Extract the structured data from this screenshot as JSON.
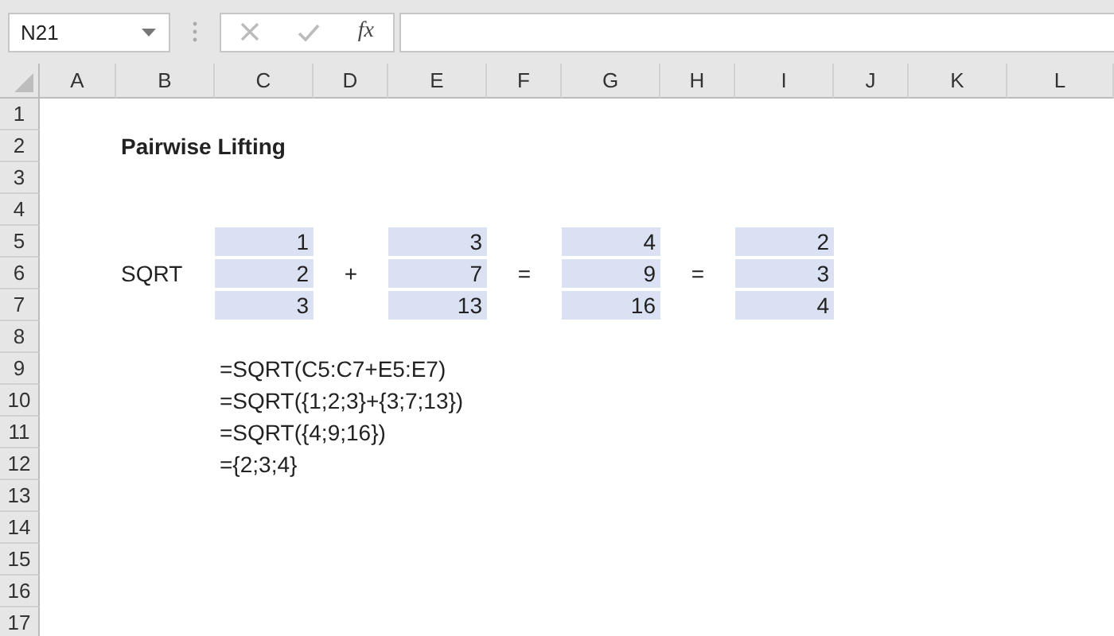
{
  "name_box": {
    "value": "N21"
  },
  "formula_bar": {
    "function_label": "fx"
  },
  "columns": [
    "A",
    "B",
    "C",
    "D",
    "E",
    "F",
    "G",
    "H",
    "I",
    "J",
    "K",
    "L"
  ],
  "rows": [
    {
      "header": "1",
      "cells": [
        null,
        null,
        null,
        null,
        null,
        null,
        null,
        null,
        null,
        null,
        null,
        null
      ]
    },
    {
      "header": "2",
      "cells": [
        null,
        {
          "value": "Pairwise Lifting",
          "kind": "title",
          "shaded": false
        },
        null,
        null,
        null,
        null,
        null,
        null,
        null,
        null,
        null,
        null
      ]
    },
    {
      "header": "3",
      "cells": [
        null,
        null,
        null,
        null,
        null,
        null,
        null,
        null,
        null,
        null,
        null,
        null
      ]
    },
    {
      "header": "4",
      "cells": [
        null,
        null,
        null,
        null,
        null,
        null,
        null,
        null,
        null,
        null,
        null,
        null
      ]
    },
    {
      "header": "5",
      "cells": [
        null,
        null,
        {
          "value": "1",
          "kind": "number",
          "shaded": true
        },
        null,
        {
          "value": "3",
          "kind": "number",
          "shaded": true
        },
        null,
        {
          "value": "4",
          "kind": "number",
          "shaded": true
        },
        null,
        {
          "value": "2",
          "kind": "number",
          "shaded": true
        },
        null,
        null,
        null
      ]
    },
    {
      "header": "6",
      "cells": [
        null,
        {
          "value": "SQRT",
          "kind": "text",
          "shaded": false
        },
        {
          "value": "2",
          "kind": "number",
          "shaded": true
        },
        {
          "value": "+",
          "kind": "operator",
          "shaded": false
        },
        {
          "value": "7",
          "kind": "number",
          "shaded": true
        },
        {
          "value": "=",
          "kind": "operator",
          "shaded": false
        },
        {
          "value": "9",
          "kind": "number",
          "shaded": true
        },
        {
          "value": "=",
          "kind": "operator",
          "shaded": false
        },
        {
          "value": "3",
          "kind": "number",
          "shaded": true
        },
        null,
        null,
        null
      ]
    },
    {
      "header": "7",
      "cells": [
        null,
        null,
        {
          "value": "3",
          "kind": "number",
          "shaded": true
        },
        null,
        {
          "value": "13",
          "kind": "number",
          "shaded": true
        },
        null,
        {
          "value": "16",
          "kind": "number",
          "shaded": true
        },
        null,
        {
          "value": "4",
          "kind": "number",
          "shaded": true
        },
        null,
        null,
        null
      ]
    },
    {
      "header": "8",
      "cells": [
        null,
        null,
        null,
        null,
        null,
        null,
        null,
        null,
        null,
        null,
        null,
        null
      ]
    },
    {
      "header": "9",
      "cells": [
        null,
        null,
        {
          "value": "=SQRT(C5:C7+E5:E7)",
          "kind": "text",
          "shaded": false
        },
        null,
        null,
        null,
        null,
        null,
        null,
        null,
        null,
        null
      ]
    },
    {
      "header": "10",
      "cells": [
        null,
        null,
        {
          "value": "=SQRT({1;2;3}+{3;7;13})",
          "kind": "text",
          "shaded": false
        },
        null,
        null,
        null,
        null,
        null,
        null,
        null,
        null,
        null
      ]
    },
    {
      "header": "11",
      "cells": [
        null,
        null,
        {
          "value": "=SQRT({4;9;16})",
          "kind": "text",
          "shaded": false
        },
        null,
        null,
        null,
        null,
        null,
        null,
        null,
        null,
        null
      ]
    },
    {
      "header": "12",
      "cells": [
        null,
        null,
        {
          "value": "={2;3;4}",
          "kind": "text",
          "shaded": false
        },
        null,
        null,
        null,
        null,
        null,
        null,
        null,
        null,
        null
      ]
    },
    {
      "header": "13",
      "cells": [
        null,
        null,
        null,
        null,
        null,
        null,
        null,
        null,
        null,
        null,
        null,
        null
      ]
    },
    {
      "header": "14",
      "cells": [
        null,
        null,
        null,
        null,
        null,
        null,
        null,
        null,
        null,
        null,
        null,
        null
      ]
    },
    {
      "header": "15",
      "cells": [
        null,
        null,
        null,
        null,
        null,
        null,
        null,
        null,
        null,
        null,
        null,
        null
      ]
    },
    {
      "header": "16",
      "cells": [
        null,
        null,
        null,
        null,
        null,
        null,
        null,
        null,
        null,
        null,
        null,
        null
      ]
    },
    {
      "header": "17",
      "cells": [
        null,
        null,
        null,
        null,
        null,
        null,
        null,
        null,
        null,
        null,
        null,
        null
      ]
    }
  ]
}
